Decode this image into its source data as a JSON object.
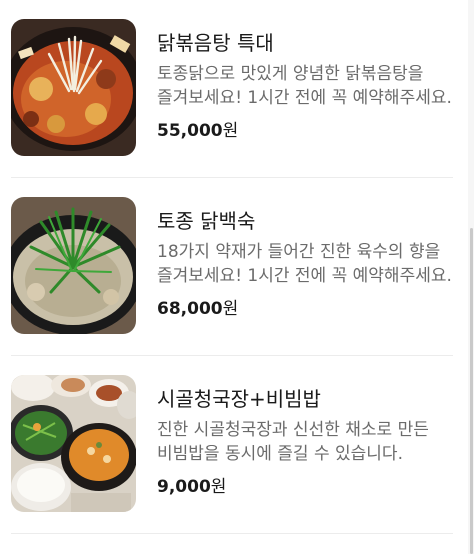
{
  "menu": {
    "items": [
      {
        "title": "닭볶음탕 특대",
        "description": "토종닭으로 맛있게 양념한 닭볶음탕을 즐겨보세요! 1시간 전에 꼭 예약해주세요.",
        "price": "55,000",
        "currency": "원",
        "image": "spicy-braised-chicken-photo"
      },
      {
        "title": "토종 닭백숙",
        "description": "18가지 약재가 들어간 진한 육수의 향을 즐겨보세요! 1시간 전에 꼭 예약해주세요.",
        "price": "68,000",
        "currency": "원",
        "image": "chicken-herbal-soup-photo"
      },
      {
        "title": "시골청국장+비빔밥",
        "description": "진한 시골청국장과 신선한 채소로 만든 비빔밥을 동시에 즐길 수 있습니다.",
        "price": "9,000",
        "currency": "원",
        "image": "cheonggukjang-bibimbap-photo"
      }
    ]
  }
}
